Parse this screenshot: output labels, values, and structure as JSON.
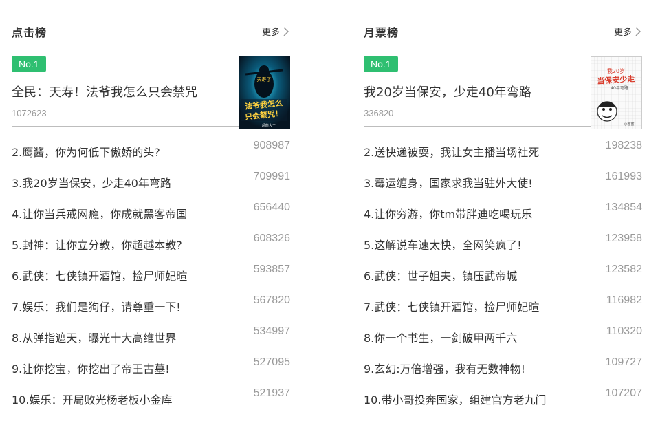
{
  "colors": {
    "badge": "#2fbf71",
    "title_text": "#333333",
    "count_text": "#999999",
    "divider": "#bdbdbd"
  },
  "panels": [
    {
      "title": "点击榜",
      "more_label": "更多",
      "more_icon": "chevron-right-icon",
      "top": {
        "badge": "No.1",
        "title": "全民：天寿！法爷我怎么只会禁咒",
        "count": "1072623",
        "cover_text_line1": "法爷我怎么",
        "cover_text_line2": "只会禁咒！",
        "cover_small": "天寿了",
        "cover_author": "超能大王"
      },
      "items": [
        {
          "title": "2.鹰酱，你为何低下傲娇的头?",
          "count": "908987"
        },
        {
          "title": "3.我20岁当保安，少走40年弯路",
          "count": "709991"
        },
        {
          "title": "4.让你当兵戒网瘾，你成就黑客帝国",
          "count": "656440"
        },
        {
          "title": "5.封神：让你立分教，你超越本教?",
          "count": "608326"
        },
        {
          "title": "6.武侠：七侠镇开酒馆，捡尸师妃暄",
          "count": "593857"
        },
        {
          "title": "7.娱乐：我们是狗仔，请尊重一下!",
          "count": "567820"
        },
        {
          "title": "8.从弹指遮天，曝光十大高维世界",
          "count": "534997"
        },
        {
          "title": "9.让你挖宝，你挖出了帝王古墓!",
          "count": "527095"
        },
        {
          "title": "10.娱乐：开局败光杨老板小金库",
          "count": "521937"
        }
      ]
    },
    {
      "title": "月票榜",
      "more_label": "更多",
      "more_icon": "chevron-right-icon",
      "top": {
        "badge": "No.1",
        "title": "我20岁当保安，少走40年弯路",
        "count": "336820",
        "cover_text_line1": "我20岁",
        "cover_text_line2": "当保安少走",
        "cover_small": "40年弯路",
        "cover_author": "小苞蜜"
      },
      "items": [
        {
          "title": "2.送快递被耍，我让女主播当场社死",
          "count": "198238"
        },
        {
          "title": "3.霉运缠身，国家求我当驻外大使!",
          "count": "161993"
        },
        {
          "title": "4.让你穷游，你tm带胖迪吃喝玩乐",
          "count": "134854"
        },
        {
          "title": "5.这解说车速太快，全网笑疯了!",
          "count": "123958"
        },
        {
          "title": "6.武侠：世子姐夫，镇压武帝城",
          "count": "123582"
        },
        {
          "title": "7.武侠：七侠镇开酒馆，捡尸师妃暄",
          "count": "116982"
        },
        {
          "title": "8.你一个书生，一剑破甲两千六",
          "count": "110320"
        },
        {
          "title": "9.玄幻:万倍增强，我有无数神物!",
          "count": "109727"
        },
        {
          "title": "10.带小哥投奔国家，组建官方老九门",
          "count": "107207"
        }
      ]
    }
  ]
}
